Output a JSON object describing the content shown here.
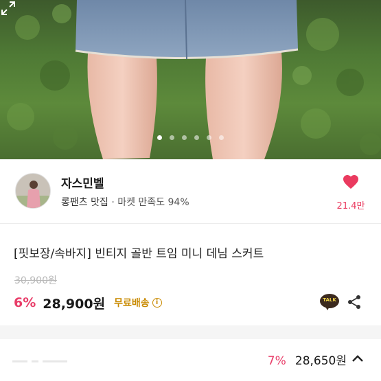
{
  "product_image": {
    "carousel_dots": 6,
    "active_dot": 0,
    "expand_icon": "expand-icon"
  },
  "seller": {
    "name": "자스민벨",
    "category": "롱팬츠 맛집",
    "separator": "·",
    "satisfaction": "마켓 만족도 94%",
    "like_count": "21.4만",
    "like_icon": "heart-icon",
    "heart_color": "#ea3a5f"
  },
  "product": {
    "title": "[핏보장/속바지] 빈티지 골반 트임 미니 데님 스커트",
    "original_price": "30,900원",
    "discount": "6%",
    "price": "28,900원",
    "shipping": "무료배송",
    "info_icon_glyph": "i",
    "kakao_label": "TALK",
    "share_icon": "share-icon"
  },
  "bottom_bar": {
    "discount": "7%",
    "price": "28,650원",
    "chevron_icon": "chevron-up-icon"
  },
  "colors": {
    "accent_pink": "#e83c68",
    "shipping_gold": "#c98a00",
    "kakao_brown": "#3c2a1e"
  }
}
